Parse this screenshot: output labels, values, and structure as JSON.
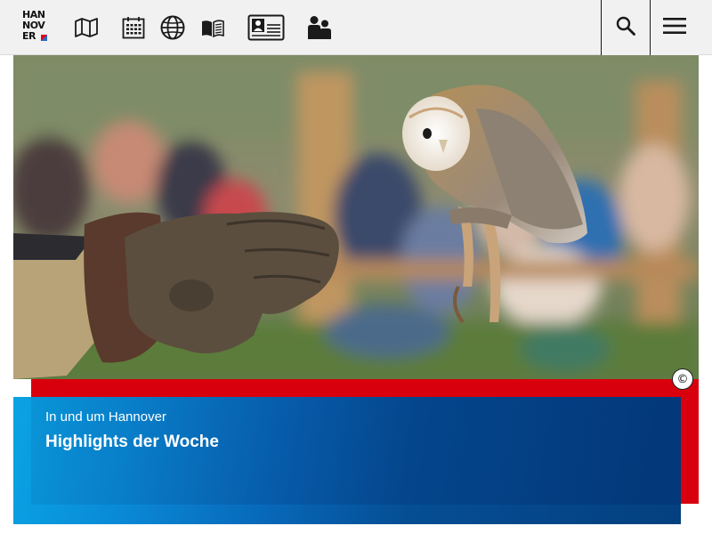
{
  "header": {
    "logo_lines": [
      "HAN",
      "NOV",
      "ER"
    ],
    "nav_icons": [
      {
        "name": "map-icon"
      },
      {
        "name": "calendar-icon"
      },
      {
        "name": "globe-icon"
      },
      {
        "name": "book-icon"
      },
      {
        "name": "id-card-icon"
      },
      {
        "name": "people-icon"
      }
    ],
    "search_icon": "search-icon",
    "menu_icon": "hamburger-menu-icon"
  },
  "hero": {
    "copyright_symbol": "©",
    "subtitle": "In und um Hannover",
    "title": "Highlights der Woche"
  },
  "colors": {
    "header_bg": "#f1f1f1",
    "red_band": "#d9000d",
    "blue_start": "#0aa3e3",
    "blue_end": "#04407f"
  }
}
